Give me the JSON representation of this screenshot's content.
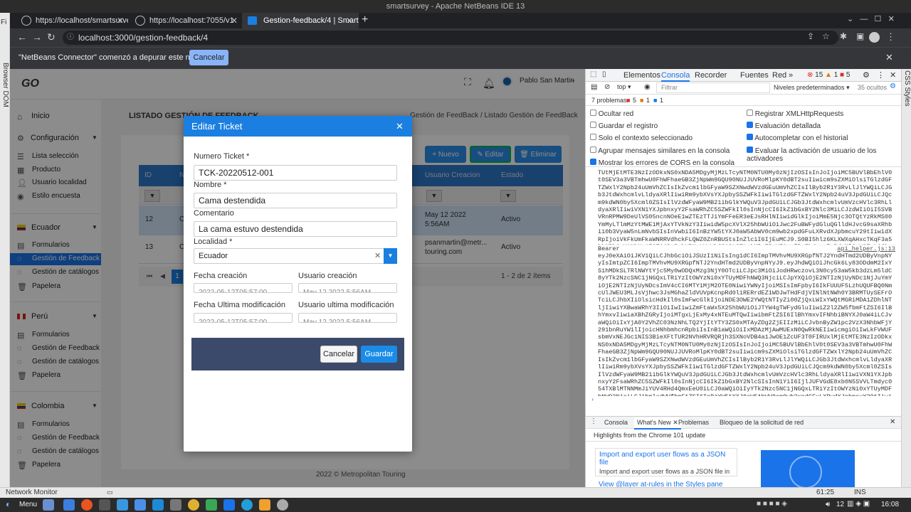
{
  "os": {
    "window_title": "smartsurvey - Apache NetBeans IDE 13"
  },
  "left_strip": {
    "label": "Browser DOM"
  },
  "right_strip": {
    "label": "CSS Styles"
  },
  "browser": {
    "tabs": [
      {
        "label": "https://localhost/smartsurvey"
      },
      {
        "label": "https://localhost:7055/v1"
      },
      {
        "label": "Gestion-feedback/4 | Smartsu"
      }
    ],
    "url": "localhost:3000/gestion-feedback/4",
    "infobar_text": "\"NetBeans Connector\" comenzó a depurar este navegador",
    "infobar_cancel": "Cancelar"
  },
  "app": {
    "logo": "GO",
    "user_name": "Pablo San Martin",
    "sidebar": {
      "inicio": "Inicio",
      "configuracion": "Configuración",
      "config_items": [
        "Lista selección",
        "Producto",
        "Usuario localidad",
        "Estilo encuesta"
      ],
      "countries": [
        {
          "name": "Ecuador",
          "items": [
            "Formularios",
            "Gestión de Feedback",
            "Gestión de catálogos de",
            "Papelera"
          ]
        },
        {
          "name": "Perú",
          "items": [
            "Formularios",
            "Gestión de Feedback",
            "Gestión de catálogos de",
            "Papelera"
          ]
        },
        {
          "name": "Colombia",
          "items": [
            "Formularios",
            "Gestión de Feedback",
            "Gestión de catálogos de",
            "Papelera"
          ]
        }
      ]
    },
    "page_title": "LISTADO GESTIÓN DE FEEDBACK",
    "breadcrumb": "Gestión de FeedBack  /  Listado Gestión de FeedBack",
    "actions": {
      "new": "Nuevo",
      "edit": "Editar",
      "delete": "Eliminar"
    },
    "table": {
      "headers": [
        "ID",
        "N",
        "Usuario Creacion",
        "Estado"
      ],
      "rows": [
        {
          "id": "12",
          "n": "C",
          "fecha": "May 12 2022",
          "hora": "5:56AM",
          "estado": "Activo"
        },
        {
          "id": "13",
          "n": "C",
          "usuario": "psanmartin@metr...",
          "usuario2": "touring.com",
          "estado": "Activo"
        }
      ],
      "pagination": "1 - 2 de 2 ítems",
      "page": "1"
    },
    "footer": "2022 © Metropolitan Touring"
  },
  "modal": {
    "title": "Editar Ticket",
    "fields": {
      "numero_label": "Numero Ticket *",
      "numero_value": "TCK-20220512-001",
      "nombre_label": "Nombre *",
      "nombre_value": "Cama destendida",
      "comentario_label": "Comentario",
      "comentario_value": "La cama estuvo destendida",
      "localidad_label": "Localidad *",
      "localidad_value": "Ecuador",
      "fecha_creacion_label": "Fecha creación",
      "fecha_creacion_value": "2022-05-12T05:57:00",
      "usuario_creacion_label": "Usuario creación",
      "usuario_creacion_value": "May 12 2022 5:56AM",
      "fecha_mod_label": "Fecha Ultima modificación",
      "fecha_mod_value": "2022-05-12T05:57:00",
      "usuario_mod_label": "Usuario ultima modificación",
      "usuario_mod_value": "May 12 2022 5:56AM"
    },
    "cancel": "Cancelar",
    "save": "Guardar"
  },
  "devtools": {
    "tabs": [
      "Elementos",
      "Consola",
      "Recorder",
      "Fuentes",
      "Red"
    ],
    "errors": "15",
    "warnings": "1",
    "issues": "5",
    "context": "top",
    "filter_placeholder": "Filtrar",
    "levels": "Niveles predeterminados",
    "hidden": "35 ocultos",
    "problems": "7 problemas:",
    "problems_err": "5",
    "problems_warn": "1",
    "problems_info": "1",
    "settings_left": [
      {
        "label": "Ocultar red",
        "checked": false
      },
      {
        "label": "Guardar el registro",
        "checked": false
      },
      {
        "label": "Solo el contexto seleccionado",
        "checked": false
      },
      {
        "label": "Agrupar mensajes similares en la consola",
        "checked": false
      },
      {
        "label": "Mostrar los errores de CORS en la consola",
        "checked": true
      }
    ],
    "settings_right": [
      {
        "label": "Registrar XMLHttpRequests",
        "checked": false
      },
      {
        "label": "Evaluación detallada",
        "checked": true
      },
      {
        "label": "Autocompletar con el historial",
        "checked": true
      },
      {
        "label": "Evaluar la activación de usuario de los activadores",
        "checked": true
      }
    ],
    "console_text_1": "TUtMjEtMTE3NzIzODkxNS0xNDA5MDgyMjMzLTcyNTM0NTU0My0zNjIzOSIsInJoIjoiMC5BUVlBbEhlV0t0SEV3a3VBTmhwU0FhWFhaeGB3ZjNpWm9GQU90NUJJUVRoMlpKY0dBT2suIiwicm9sZXMiOlsiTGlzdGFTZWxlY2Npb24uUmVhZCIsIkZvcm1lbGFyaW9SZXNwdWVzdGEuUmVhZCIsIlByb2R1Y3RvLlJlYWQiLCJGb3JtdWxhcmlvLldyaXRlIiwiRm9ybXVsYXJpbySSZWFkIiwiTGlzdGFTZWxlY2Npb24uV3JpdGUiLCJQcm9kdWN0by5Xcml0ZSIsIlVzdWFyaW9MB21ibGlkYWQuV3JpdGUiLCJGb3JtdWxhcmlvUmVzcHVlc3RhLldyaXRlIiwiVXN1YXJpbnxyY2FsaWRhZC5SZWFkIl0sInNjcCI6IkZ1bGxBY2Nlc3MiLCJzdWIiOiI5SVBVRnRPMW9DeUlVS05ncnNOeE1wZTEzTTJiYmFFeER3eEJsRHlNIiwidGlkIjoiMmE5Njc3OTQtYzRkMS00YmMyLTlmMzYtMWE1MjAxYTVkNzY3IiwidW5pcXVlX25hbWUiOiJwc2FuBWFydGluQGlldHJvcG9saXRhbi10b3VyaW5nLmNvbSIsInVwbiI6InBzYW5tYXJ0aW5AbWV0cm9wb2xpdGFuLXRvdXJpbmcuY29tIiwidXRpIjoiVkFkUmFkaWNRRVdhckFLQWZ0ZnRBUStsInZlciI6IjEuMCJ9.S0BI5hlz6KLXWXqAHxcTKqF3a5khKRbjyYANkNn15GEij8zBebWRNsLWnWbJ2AOt2ZtobMlwERqVFA-u7PpEbdpzmEmPdvMl6-WGEsLiJkvdJ_yJQS_LAME6yfhevrJgF2K8OjKHr8VVyM6MLGi2IYfLZWHBg0bCWtXDMX4bZiqiJPd0udD3L85cfOBVDcbuOpn31c5oxCyXzQIMI1HW8_oyHXRiYPfGINnNeTWeXa9pg5Faq0vRMLkGbSR-WAv31s183bVMf6xDvIaI_QjggaYDdqMsdM3cG_mXNXdBDsoejRPstom61ig3cXm1HH-WX9IYAs17sM4aWv7A0-Lg",
    "console_bearer": "Bearer",
    "console_source": "api_helper.js:13",
    "console_text_2": "eyJ0eXAiOiJKV1QiLCJhbGciOiJSUzI1NiIsIng1dCI6ImpTMVhvMU9XRGpfNTJ2YndHTmd2UDByVnpNYyIsImtpZCI6ImpTMVhvMU9XRGpfNTJ2YndHTmd2UDByVnpNYyJ9.eyJhdWQiOiJhcGk6Ly83ODdmM2IxYS1hMDkSLTRlNWYtYjc5My0wODQxMzg3NjY0OTciLCJpc3MiOiJodHRwczovL3N0cy53aW5kb3dzLm5ldC8yYTk2NzcSNC1jNGQxLTRiYzItOWYzNi0xYTUyMDFhNWQ3NjciLCJpYXQiOjE2NTIzNjUyNDc1NjJuYmYiOjE2NTIzNjUyNDcsImV4cCI6MTY1MjM2OTE0NiwiYWNyIjoiMSIsImFpbyI6IkFUUUF5LzhUQUFBQ0NmcUlJWEU3MLJsVjhwc3JsMGhaZldVUVpKcnpRd0l1RERrdEZ1WDJwTHdFdjVINlNtNWh0Y3BRMTUySEFrOTciLCJhbXIiOlsicHdkIl0sImFwcGlkIjoiNDE3OWE2YWQtNTIyZi00ZjQxLWIxYWQtMGRiMDA1ZDhlNTljIiwiYXBwaWRhY3IiOiIwIiwiZmFtaWx5X25hbWUiOiJTYW4gTWFydGluIiwiZ2l2ZW5fbmFtZSI6IlBhYmxvIiwiaXBhZGRyIjoiMTgxLjExMy4xNTEuMTQwIiwibmFtZSI6IlBhYmxvIFNhbiBNYXJ0aW4iLCJvaWQiOiIxYjA0Y2VhZC03NzNhLTQ2YjItYTY3ZS0xMTAyZDg2ZjEIIzMiLCJvbnByZW1pc2VzX3NhbWFjY291bnRuYW1lIjoicHNhbmhcnRpbiIsInB1aWQiOiIxMDAzMjAwMUExN0QwRkNEIiwicmgiOiIwLkFVWUFsbmVxNEJGc1NIS3BieXFtTUR2NVhHRVRQRjh3SXNoVDB4a1JwOE1ZcUF3T0FIRUxlMjEtMTE3NzIzODkxNS0xNDA5MDgyMjMzLTcyNTM0NTU0My0zNjIzOSIsInJoIjoiMC5BUVlBbEhlV0t0SEV3a3VBTmhwU0FhWFhaeGB3ZjNpWm9GQU90NUJJUVRoMlpKY0dBT2suIiwicm9sZXMiOlsiTGlzdGFTZWxlY2Npb24uUmVhZCIsIkZvcm1lbGFyaW9SZXNwdWVzdGEuUmVhZCIsIlByb2R1Y3RvLlJlYWQiLCJGb3JtdWxhcmlvLldyaXRlIiwiRm9ybXVsYXJpbySSZWFkIiwiTGlzdGFTZWxlY2Npb24uV3JpdGUiLCJQcm9kdWN0by5Xcml0ZSIsIlVzdWFyaW9MB21ibGlkYWQuV3JpdGUiLCJGb3JtdWxhcmlvUmVzcHVlc3RhLldyaXRlIiwiVXN1YXJpbnxyY2FsaWRhZC5SZWFkIl0sInNjcCI6IkZ1bGxBY2NlcSIsInN1YiI6IjlJUFVGdE8xb0N5SVVLTmdyc054TXBlMTNNMmJiYUV4RHd4QmxEeU0iLCJ0aWQiOiIyYTk2Nzc5NC1jNGQxLTRiYzItOWYzNi0xYTUyMDFhNWQ3NjciLCJ1bmlxdWVfbmFtZSI6InBzYW5tYXJ0aW5AbWV0cm9wb2xpdGFuLXRvdXJpbmcuY29tIiwidXBuIjoicHNhbmhcnRpbkBtZXRyb3BvbGl0YW4tdG91cmluZy5jb20iLCJ1dGkiOiJWQWRSYWRpY1FFV2FyQUtBZnRmdEFRIiwidmVyIjoiMS4wIn0.S0BI5hlz6KLXWXqAHxcTKqF3a5khKRbjyYANkNn15GEij8zBebWRNsLWnWbJ2AOt2ZtobMlwERqVFA-u7PpEbdpzmEmPdvMl6-WGEsLiJkvdJ_yJQS_LAME6yfhevrJgF2K8OjKHr8VVyM6MLGi2IYfLZWHBg0bCWtXDMX4bZiqiJPd0udD3L85cfOBVDcbuOpn31c5oxCyXzQIMI1HW8_oyHXRiYPfGINnNeTWeXa9pg5Faq0vRMLkGbSR-WAv31s183bVMf6xDvIaI_QjggaYDdqMsdM3cG_mXNXdBDsoejRPstom61ig3cXm1HH-WX9IYAs17sM4aWv7A0-Lg",
    "drawer_tabs": [
      "Consola",
      "What's New",
      "Problemas",
      "Bloqueo de la solicitud de red"
    ],
    "whats_new_title": "Highlights from the Chrome 101 update",
    "card1_title": "Import and export user flows as a JSON file",
    "card1_body": "Import and export user flows as a JSON file in the Recorder panel.",
    "card2_title": "View @layer at-rules in the Styles pane"
  },
  "statusbar": {
    "left": "Network Monitor",
    "pos": "61:25",
    "mode": "INS"
  },
  "taskbar": {
    "menu": "Menu",
    "volume": "12",
    "time": "16:08"
  },
  "colors": {
    "primary": "#1a7fe0",
    "modal_footer": "#3b4a6b",
    "sidebar_selected": "#1a73e8"
  }
}
